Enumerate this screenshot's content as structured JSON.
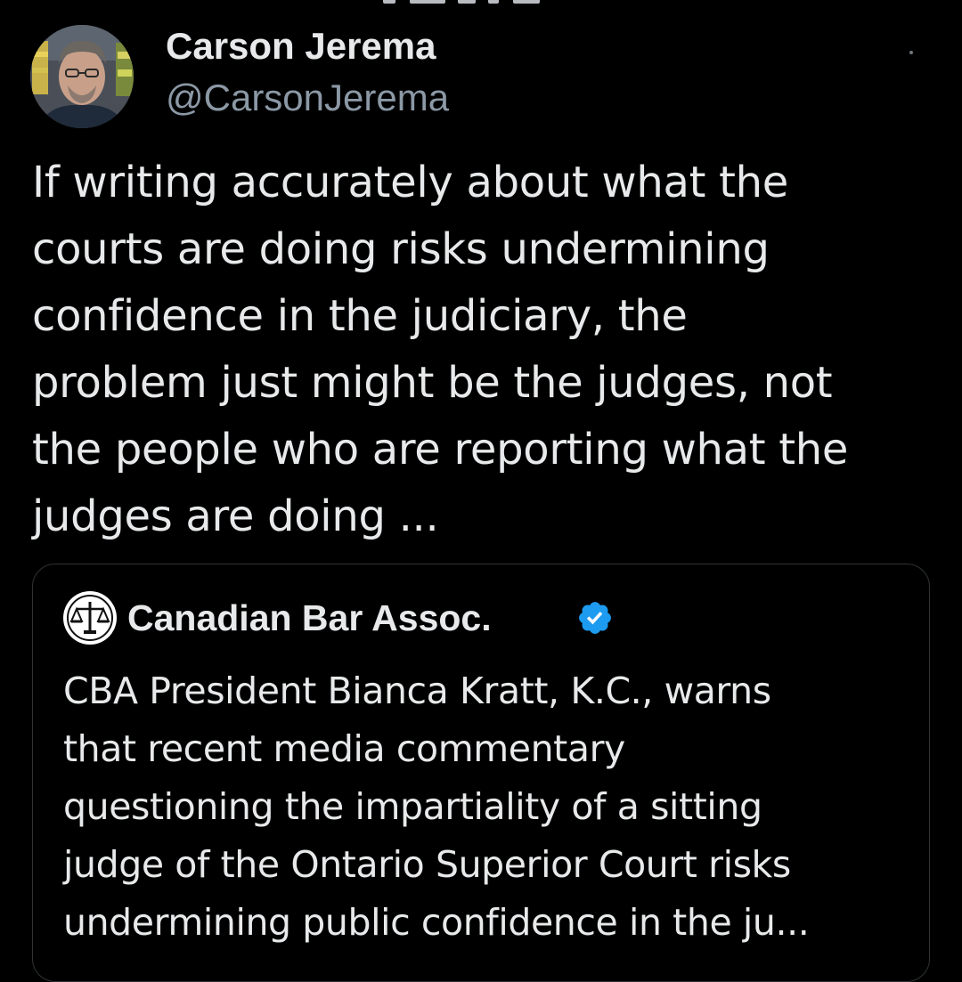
{
  "tweet": {
    "author": {
      "name": "Carson Jerema",
      "handle": "@CarsonJerema"
    },
    "text": "If writing accurately about what the\ncourts are doing risks undermining\nconfidence in the judiciary, the\nproblem just might be the judges, not\nthe people who are reporting what the\njudges are doing ..."
  },
  "quoted_tweet": {
    "author": {
      "name": "Canadian Bar Assoc.",
      "verified": true
    },
    "text": "CBA President Bianca Kratt, K.C., warns\nthat recent media commentary\nquestioning the impartiality of a sitting\njudge of the Ontario Superior Court risks\nundermining public confidence in the ju..."
  },
  "icons": {
    "avatar": "profile-photo",
    "quote_avatar": "scales-of-justice-logo",
    "verified": "verified-checkmark-badge",
    "more": "more-options-dot"
  },
  "colors": {
    "background": "#000000",
    "primary_text": "#e7e9ea",
    "secondary_text": "#8b98a5",
    "border": "#2f3336",
    "verified_blue": "#1d9bf0"
  }
}
